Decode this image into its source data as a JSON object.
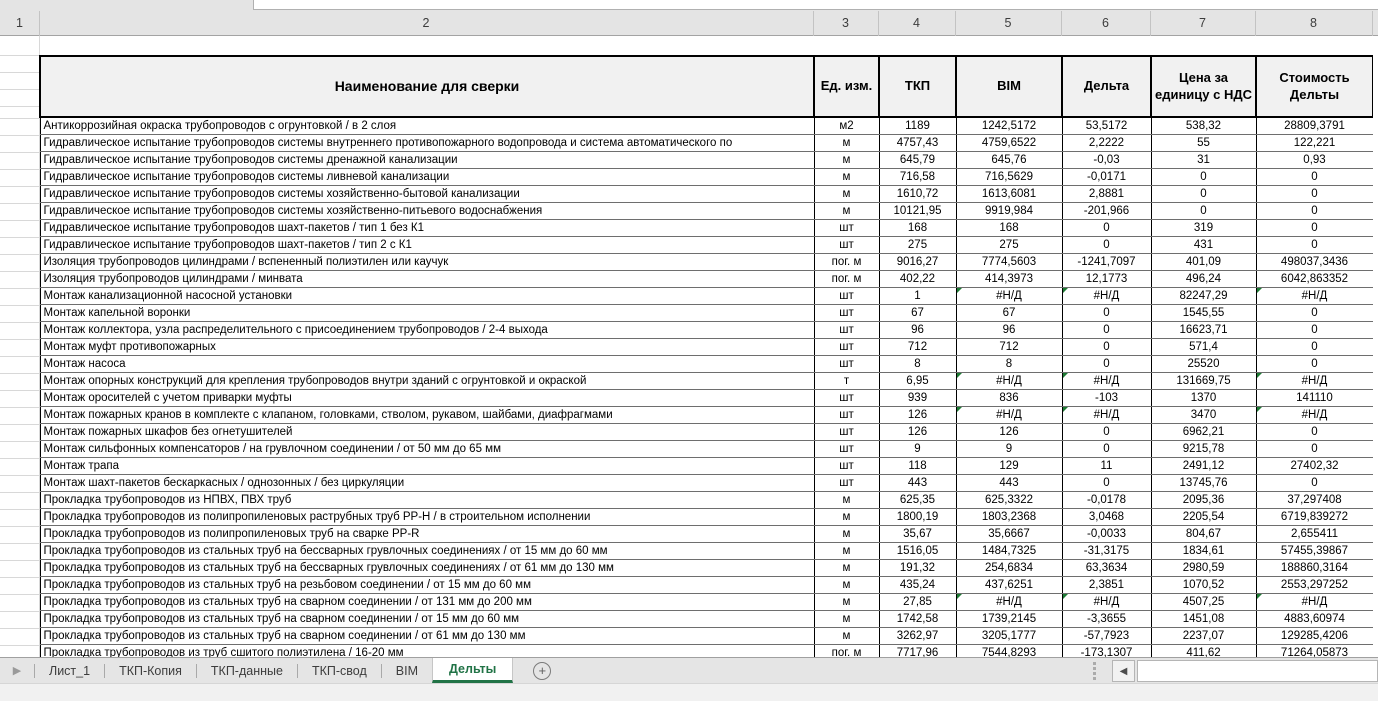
{
  "grid": {
    "column_numbers": [
      "1",
      "2",
      "3",
      "4",
      "5",
      "6",
      "7",
      "8"
    ]
  },
  "table": {
    "headers": {
      "name": "Наименование для сверки",
      "unit": "Ед. изм.",
      "tkp": "ТКП",
      "bim": "BIM",
      "delta": "Дельта",
      "price": "Цена за единицу с НДС",
      "cost": "Стоимость Дельты"
    },
    "error_value": "#Н/Д",
    "rows": [
      {
        "name": "Антикоррозийная окраска трубопроводов с огрунтовкой / в 2 слоя",
        "unit": "м2",
        "tkp": "1189",
        "bim": "1242,5172",
        "delta": "53,5172",
        "price": "538,32",
        "cost": "28809,3791"
      },
      {
        "name": "Гидравлическое испытание трубопроводов системы внутреннего противопожарного водопровода и система автоматического по",
        "unit": "м",
        "tkp": "4757,43",
        "bim": "4759,6522",
        "delta": "2,2222",
        "price": "55",
        "cost": "122,221"
      },
      {
        "name": "Гидравлическое испытание трубопроводов системы дренажной канализации",
        "unit": "м",
        "tkp": "645,79",
        "bim": "645,76",
        "delta": "-0,03",
        "price": "31",
        "cost": "0,93"
      },
      {
        "name": "Гидравлическое испытание трубопроводов системы ливневой канализации",
        "unit": "м",
        "tkp": "716,58",
        "bim": "716,5629",
        "delta": "-0,0171",
        "price": "0",
        "cost": "0"
      },
      {
        "name": "Гидравлическое испытание трубопроводов системы хозяйственно-бытовой канализации",
        "unit": "м",
        "tkp": "1610,72",
        "bim": "1613,6081",
        "delta": "2,8881",
        "price": "0",
        "cost": "0"
      },
      {
        "name": "Гидравлическое испытание трубопроводов системы хозяйственно-питьевого водоснабжения",
        "unit": "м",
        "tkp": "10121,95",
        "bim": "9919,984",
        "delta": "-201,966",
        "price": "0",
        "cost": "0"
      },
      {
        "name": "Гидравлическое испытание трубопроводов шахт-пакетов / тип 1 без К1",
        "unit": "шт",
        "tkp": "168",
        "bim": "168",
        "delta": "0",
        "price": "319",
        "cost": "0"
      },
      {
        "name": "Гидравлическое испытание трубопроводов шахт-пакетов / тип 2 с К1",
        "unit": "шт",
        "tkp": "275",
        "bim": "275",
        "delta": "0",
        "price": "431",
        "cost": "0"
      },
      {
        "name": "Изоляция трубопроводов цилиндрами / вспененный полиэтилен или каучук",
        "unit": "пог. м",
        "tkp": "9016,27",
        "bim": "7774,5603",
        "delta": "-1241,7097",
        "price": "401,09",
        "cost": "498037,3436"
      },
      {
        "name": "Изоляция трубопроводов цилиндрами / минвата",
        "unit": "пог. м",
        "tkp": "402,22",
        "bim": "414,3973",
        "delta": "12,1773",
        "price": "496,24",
        "cost": "6042,863352"
      },
      {
        "name": "Монтаж канализационной насосной установки",
        "unit": "шт",
        "tkp": "1",
        "bim": "#Н/Д",
        "delta": "#Н/Д",
        "price": "82247,29",
        "cost": "#Н/Д"
      },
      {
        "name": "Монтаж капельной воронки",
        "unit": "шт",
        "tkp": "67",
        "bim": "67",
        "delta": "0",
        "price": "1545,55",
        "cost": "0"
      },
      {
        "name": "Монтаж коллектора, узла распределительного с присоединением трубопроводов / 2-4 выхода",
        "unit": "шт",
        "tkp": "96",
        "bim": "96",
        "delta": "0",
        "price": "16623,71",
        "cost": "0"
      },
      {
        "name": "Монтаж муфт противопожарных",
        "unit": "шт",
        "tkp": "712",
        "bim": "712",
        "delta": "0",
        "price": "571,4",
        "cost": "0"
      },
      {
        "name": "Монтаж насоса",
        "unit": "шт",
        "tkp": "8",
        "bim": "8",
        "delta": "0",
        "price": "25520",
        "cost": "0"
      },
      {
        "name": "Монтаж опорных конструкций для крепления трубопроводов внутри зданий с огрунтовкой и окраской",
        "unit": "т",
        "tkp": "6,95",
        "bim": "#Н/Д",
        "delta": "#Н/Д",
        "price": "131669,75",
        "cost": "#Н/Д"
      },
      {
        "name": "Монтаж оросителей с учетом приварки муфты",
        "unit": "шт",
        "tkp": "939",
        "bim": "836",
        "delta": "-103",
        "price": "1370",
        "cost": "141110"
      },
      {
        "name": "Монтаж пожарных кранов в комплекте с клапаном, головками, стволом, рукавом, шайбами, диафрагмами",
        "unit": "шт",
        "tkp": "126",
        "bim": "#Н/Д",
        "delta": "#Н/Д",
        "price": "3470",
        "cost": "#Н/Д"
      },
      {
        "name": "Монтаж пожарных шкафов без огнетушителей",
        "unit": "шт",
        "tkp": "126",
        "bim": "126",
        "delta": "0",
        "price": "6962,21",
        "cost": "0"
      },
      {
        "name": "Монтаж сильфонных компенсаторов / на грувлочном соединении / от 50 мм до 65 мм",
        "unit": "шт",
        "tkp": "9",
        "bim": "9",
        "delta": "0",
        "price": "9215,78",
        "cost": "0"
      },
      {
        "name": "Монтаж трапа",
        "unit": "шт",
        "tkp": "118",
        "bim": "129",
        "delta": "11",
        "price": "2491,12",
        "cost": "27402,32"
      },
      {
        "name": "Монтаж шахт-пакетов бескаркасных / однозонных / без циркуляции",
        "unit": "шт",
        "tkp": "443",
        "bim": "443",
        "delta": "0",
        "price": "13745,76",
        "cost": "0"
      },
      {
        "name": "Прокладка трубопроводов из НПВХ, ПВХ труб",
        "unit": "м",
        "tkp": "625,35",
        "bim": "625,3322",
        "delta": "-0,0178",
        "price": "2095,36",
        "cost": "37,297408"
      },
      {
        "name": "Прокладка трубопроводов из полипропиленовых раструбных труб PP-H / в строительном исполнении",
        "unit": "м",
        "tkp": "1800,19",
        "bim": "1803,2368",
        "delta": "3,0468",
        "price": "2205,54",
        "cost": "6719,839272"
      },
      {
        "name": "Прокладка трубопроводов из полипропиленовых труб на сварке PP-R",
        "unit": "м",
        "tkp": "35,67",
        "bim": "35,6667",
        "delta": "-0,0033",
        "price": "804,67",
        "cost": "2,655411"
      },
      {
        "name": "Прокладка трубопроводов из стальных труб на бессварных грувлочных соединениях / от 15 мм до 60 мм",
        "unit": "м",
        "tkp": "1516,05",
        "bim": "1484,7325",
        "delta": "-31,3175",
        "price": "1834,61",
        "cost": "57455,39867"
      },
      {
        "name": "Прокладка трубопроводов из стальных труб на бессварных грувлочных соединениях / от 61 мм до 130 мм",
        "unit": "м",
        "tkp": "191,32",
        "bim": "254,6834",
        "delta": "63,3634",
        "price": "2980,59",
        "cost": "188860,3164"
      },
      {
        "name": "Прокладка трубопроводов из стальных труб на резьбовом соединении / от 15 мм до 60 мм",
        "unit": "м",
        "tkp": "435,24",
        "bim": "437,6251",
        "delta": "2,3851",
        "price": "1070,52",
        "cost": "2553,297252"
      },
      {
        "name": "Прокладка трубопроводов из стальных труб на сварном соединении / от 131 мм до 200 мм",
        "unit": "м",
        "tkp": "27,85",
        "bim": "#Н/Д",
        "delta": "#Н/Д",
        "price": "4507,25",
        "cost": "#Н/Д"
      },
      {
        "name": "Прокладка трубопроводов из стальных труб на сварном соединении / от 15 мм до 60 мм",
        "unit": "м",
        "tkp": "1742,58",
        "bim": "1739,2145",
        "delta": "-3,3655",
        "price": "1451,08",
        "cost": "4883,60974"
      },
      {
        "name": "Прокладка трубопроводов из стальных труб на сварном соединении / от 61 мм до 130 мм",
        "unit": "м",
        "tkp": "3262,97",
        "bim": "3205,1777",
        "delta": "-57,7923",
        "price": "2237,07",
        "cost": "129285,4206"
      },
      {
        "name": "Прокладка трубопроводов из труб сшитого полиэтилена / 16-20 мм",
        "unit": "пог. м",
        "tkp": "7717,96",
        "bim": "7544,8293",
        "delta": "-173,1307",
        "price": "411,62",
        "cost": "71264,05873"
      }
    ]
  },
  "tabs": {
    "sheets": [
      "Лист_1",
      "ТКП-Копия",
      "ТКП-данные",
      "ТКП-свод",
      "BIM",
      "Дельты"
    ],
    "active": "Дельты",
    "add_label": "+",
    "nav_arrow": "▶",
    "scroll_left_arrow": "◀"
  },
  "colors": {
    "active_tab_green": "#217346",
    "error_indicator_green": "#1e7b34",
    "header_fill": "#f1f1f1",
    "chrome_grey": "#e4e4e4"
  }
}
